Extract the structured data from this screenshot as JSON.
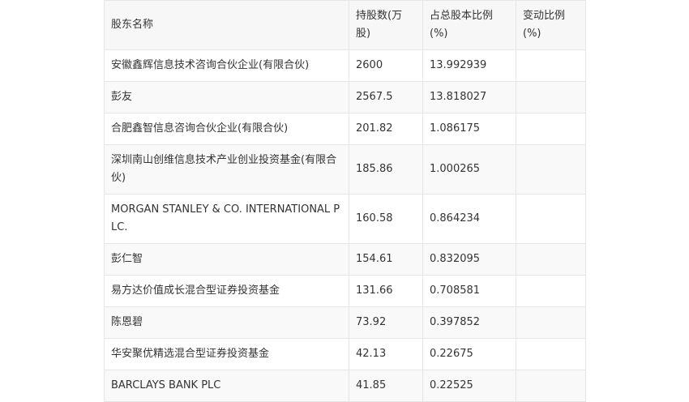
{
  "table": {
    "headers": [
      "股东名称",
      "持股数(万股)",
      "占总股本比例(%)",
      "变动比例(%)"
    ],
    "rows": [
      {
        "name": "安徽鑫辉信息技术咨询合伙企业(有限合伙)",
        "shares": "2600",
        "ratio": "13.992939",
        "change": ""
      },
      {
        "name": "彭友",
        "shares": "2567.5",
        "ratio": "13.818027",
        "change": ""
      },
      {
        "name": "合肥鑫智信息咨询合伙企业(有限合伙)",
        "shares": "201.82",
        "ratio": "1.086175",
        "change": ""
      },
      {
        "name": "深圳南山创维信息技术产业创业投资基金(有限合伙)",
        "shares": "185.86",
        "ratio": "1.000265",
        "change": ""
      },
      {
        "name": "MORGAN STANLEY & CO. INTERNATIONAL PLC.",
        "shares": "160.58",
        "ratio": "0.864234",
        "change": ""
      },
      {
        "name": "彭仁智",
        "shares": "154.61",
        "ratio": "0.832095",
        "change": ""
      },
      {
        "name": "易方达价值成长混合型证券投资基金",
        "shares": "131.66",
        "ratio": "0.708581",
        "change": ""
      },
      {
        "name": "陈恩碧",
        "shares": "73.92",
        "ratio": "0.397852",
        "change": ""
      },
      {
        "name": "华安聚优精选混合型证券投资基金",
        "shares": "42.13",
        "ratio": "0.22675",
        "change": ""
      },
      {
        "name": "BARCLAYS BANK PLC",
        "shares": "41.85",
        "ratio": "0.22525",
        "change": ""
      }
    ]
  }
}
